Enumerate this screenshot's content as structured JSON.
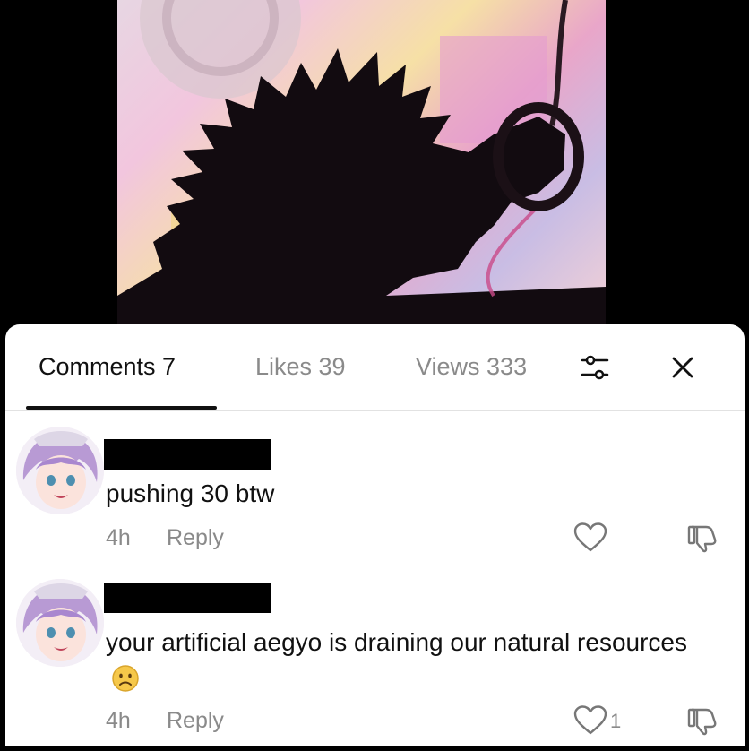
{
  "tabs": {
    "comments": "Comments 7",
    "likes": "Likes 39",
    "views": "Views 333"
  },
  "icons": {
    "filter": "sliders-icon",
    "close": "close-icon",
    "like": "heart-icon",
    "dislike": "thumbs-down-icon",
    "emoji": "frowning-face-emoji"
  },
  "comments": [
    {
      "text": "pushing 30 btw",
      "time": "4h",
      "reply": "Reply",
      "likes": ""
    },
    {
      "text": "your artificial aegyo is draining our natural resources",
      "time": "4h",
      "reply": "Reply",
      "likes": "1"
    }
  ],
  "colors": {
    "active_tab": "#111111",
    "inactive_tab": "#8a8a8a",
    "sheet_bg": "#ffffff"
  }
}
